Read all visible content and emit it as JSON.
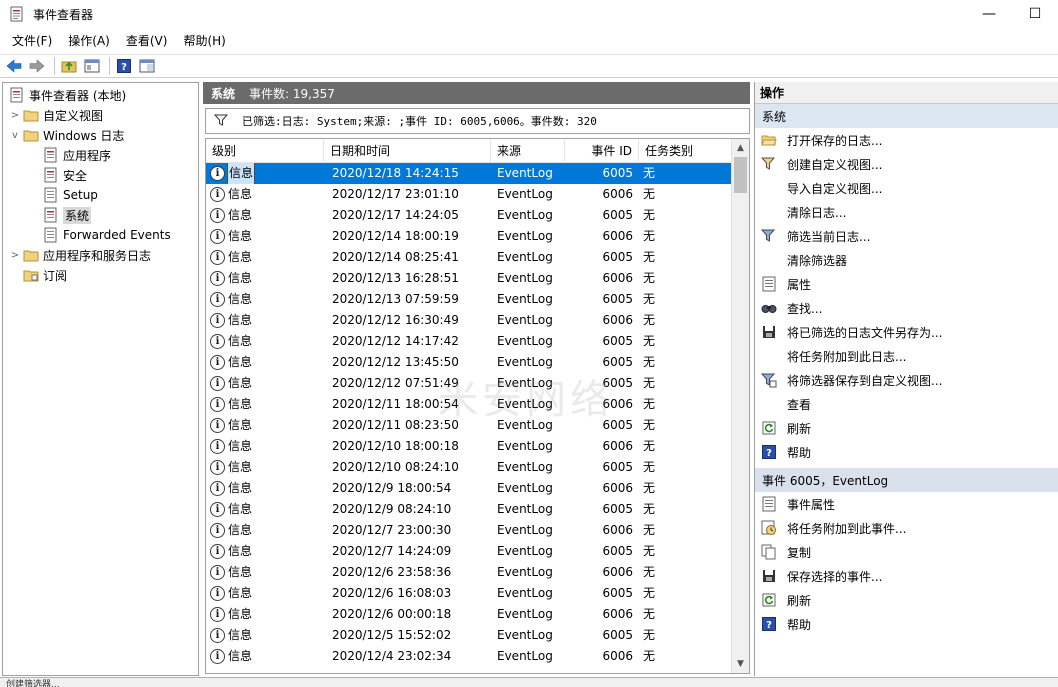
{
  "window": {
    "title": "事件查看器",
    "minimize": "—",
    "maximize": "☐"
  },
  "menu": [
    "文件(F)",
    "操作(A)",
    "查看(V)",
    "帮助(H)"
  ],
  "toolbar_icons": [
    "back-icon",
    "forward-icon",
    "folder-up-icon",
    "show-pane-icon",
    "help-icon",
    "properties-icon"
  ],
  "tree": {
    "root": "事件查看器 (本地)",
    "custom_views": "自定义视图",
    "windows_logs": "Windows 日志",
    "app": "应用程序",
    "security": "安全",
    "setup": "Setup",
    "system": "系统",
    "forwarded": "Forwarded Events",
    "app_services": "应用程序和服务日志",
    "subscriptions": "订阅"
  },
  "middle": {
    "header": "系统",
    "event_count": "事件数: 19,357",
    "filter_text": "已筛选:日志: System;来源: ;事件 ID: 6005,6006。事件数: 320",
    "columns": [
      "级别",
      "日期和时间",
      "来源",
      "事件 ID",
      "任务类别"
    ],
    "watermark": "米安网络",
    "rows": [
      {
        "level": "信息",
        "date": "2020/12/18 14:24:15",
        "source": "EventLog",
        "id": "6005",
        "task": "无"
      },
      {
        "level": "信息",
        "date": "2020/12/17 23:01:10",
        "source": "EventLog",
        "id": "6006",
        "task": "无"
      },
      {
        "level": "信息",
        "date": "2020/12/17 14:24:05",
        "source": "EventLog",
        "id": "6005",
        "task": "无"
      },
      {
        "level": "信息",
        "date": "2020/12/14 18:00:19",
        "source": "EventLog",
        "id": "6006",
        "task": "无"
      },
      {
        "level": "信息",
        "date": "2020/12/14 08:25:41",
        "source": "EventLog",
        "id": "6005",
        "task": "无"
      },
      {
        "level": "信息",
        "date": "2020/12/13 16:28:51",
        "source": "EventLog",
        "id": "6006",
        "task": "无"
      },
      {
        "level": "信息",
        "date": "2020/12/13 07:59:59",
        "source": "EventLog",
        "id": "6005",
        "task": "无"
      },
      {
        "level": "信息",
        "date": "2020/12/12 16:30:49",
        "source": "EventLog",
        "id": "6006",
        "task": "无"
      },
      {
        "level": "信息",
        "date": "2020/12/12 14:17:42",
        "source": "EventLog",
        "id": "6005",
        "task": "无"
      },
      {
        "level": "信息",
        "date": "2020/12/12 13:45:50",
        "source": "EventLog",
        "id": "6005",
        "task": "无"
      },
      {
        "level": "信息",
        "date": "2020/12/12 07:51:49",
        "source": "EventLog",
        "id": "6005",
        "task": "无"
      },
      {
        "level": "信息",
        "date": "2020/12/11 18:00:54",
        "source": "EventLog",
        "id": "6006",
        "task": "无"
      },
      {
        "level": "信息",
        "date": "2020/12/11 08:23:50",
        "source": "EventLog",
        "id": "6005",
        "task": "无"
      },
      {
        "level": "信息",
        "date": "2020/12/10 18:00:18",
        "source": "EventLog",
        "id": "6006",
        "task": "无"
      },
      {
        "level": "信息",
        "date": "2020/12/10 08:24:10",
        "source": "EventLog",
        "id": "6005",
        "task": "无"
      },
      {
        "level": "信息",
        "date": "2020/12/9 18:00:54",
        "source": "EventLog",
        "id": "6006",
        "task": "无"
      },
      {
        "level": "信息",
        "date": "2020/12/9 08:24:10",
        "source": "EventLog",
        "id": "6005",
        "task": "无"
      },
      {
        "level": "信息",
        "date": "2020/12/7 23:00:30",
        "source": "EventLog",
        "id": "6006",
        "task": "无"
      },
      {
        "level": "信息",
        "date": "2020/12/7 14:24:09",
        "source": "EventLog",
        "id": "6005",
        "task": "无"
      },
      {
        "level": "信息",
        "date": "2020/12/6 23:58:36",
        "source": "EventLog",
        "id": "6006",
        "task": "无"
      },
      {
        "level": "信息",
        "date": "2020/12/6 16:08:03",
        "source": "EventLog",
        "id": "6005",
        "task": "无"
      },
      {
        "level": "信息",
        "date": "2020/12/6 00:00:18",
        "source": "EventLog",
        "id": "6006",
        "task": "无"
      },
      {
        "level": "信息",
        "date": "2020/12/5 15:52:02",
        "source": "EventLog",
        "id": "6005",
        "task": "无"
      },
      {
        "level": "信息",
        "date": "2020/12/4 23:02:34",
        "source": "EventLog",
        "id": "6006",
        "task": "无"
      }
    ]
  },
  "actions": {
    "title": "操作",
    "section1": "系统",
    "items1": [
      {
        "label": "打开保存的日志...",
        "icon": "open-folder-icon"
      },
      {
        "label": "创建自定义视图...",
        "icon": "filter-create-icon"
      },
      {
        "label": "导入自定义视图...",
        "icon": ""
      },
      {
        "label": "清除日志...",
        "icon": ""
      },
      {
        "label": "筛选当前日志...",
        "icon": "filter-icon"
      },
      {
        "label": "清除筛选器",
        "icon": ""
      },
      {
        "label": "属性",
        "icon": "properties-icon"
      },
      {
        "label": "查找...",
        "icon": "find-icon"
      },
      {
        "label": "将已筛选的日志文件另存为...",
        "icon": "save-icon"
      },
      {
        "label": "将任务附加到此日志...",
        "icon": ""
      },
      {
        "label": "将筛选器保存到自定义视图...",
        "icon": "filter-save-icon"
      },
      {
        "label": "查看",
        "icon": ""
      },
      {
        "label": "刷新",
        "icon": "refresh-icon"
      },
      {
        "label": "帮助",
        "icon": "help-icon"
      }
    ],
    "section2": "事件 6005，EventLog",
    "items2": [
      {
        "label": "事件属性",
        "icon": "properties-icon"
      },
      {
        "label": "将任务附加到此事件...",
        "icon": "task-icon"
      },
      {
        "label": "复制",
        "icon": "copy-icon"
      },
      {
        "label": "保存选择的事件...",
        "icon": "save-icon"
      },
      {
        "label": "刷新",
        "icon": "refresh-icon"
      },
      {
        "label": "帮助",
        "icon": "help-icon"
      }
    ]
  },
  "status": "创建筛选器..."
}
